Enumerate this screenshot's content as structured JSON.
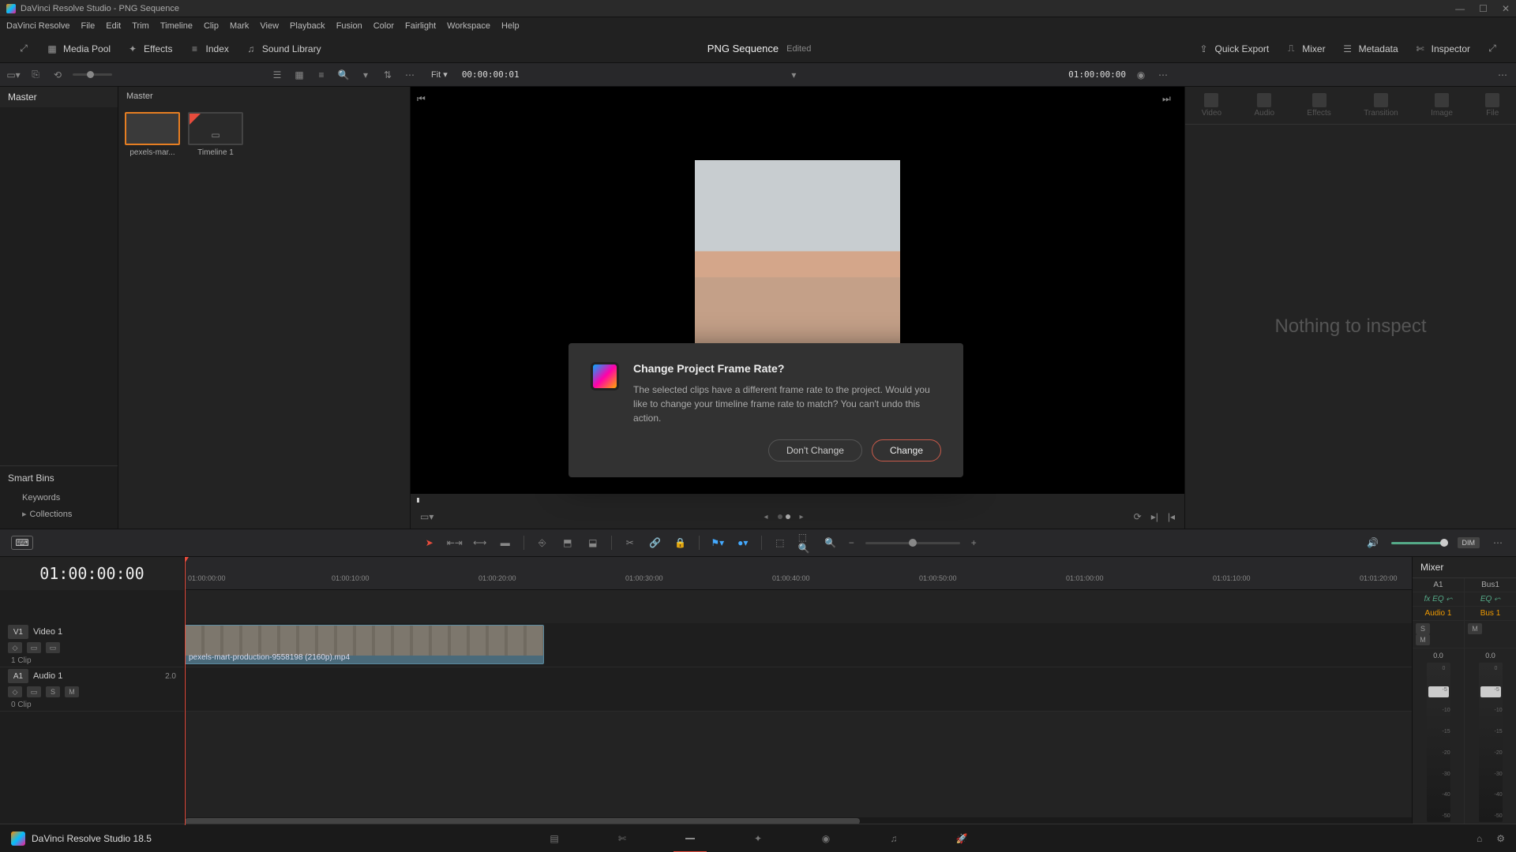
{
  "app": {
    "title": "DaVinci Resolve Studio - PNG Sequence"
  },
  "menu": [
    "DaVinci Resolve",
    "File",
    "Edit",
    "Trim",
    "Timeline",
    "Clip",
    "Mark",
    "View",
    "Playback",
    "Fusion",
    "Color",
    "Fairlight",
    "Workspace",
    "Help"
  ],
  "toolbar": {
    "mediaPool": "Media Pool",
    "effects": "Effects",
    "index": "Index",
    "soundLibrary": "Sound Library",
    "quickExport": "Quick Export",
    "mixer": "Mixer",
    "metadata": "Metadata",
    "inspector": "Inspector",
    "projectTitle": "PNG Sequence",
    "projectState": "Edited"
  },
  "subToolbar": {
    "fit": "Fit",
    "sourceTC": "00:00:00:01",
    "recordTC": "01:00:00:00"
  },
  "mediaPool": {
    "master": "Master",
    "masterCrumb": "Master",
    "clips": [
      {
        "label": "pexels-mar..."
      },
      {
        "label": "Timeline 1"
      }
    ],
    "smartBins": "Smart Bins",
    "keywords": "Keywords",
    "collections": "Collections"
  },
  "inspector": {
    "tabs": [
      "Video",
      "Audio",
      "Effects",
      "Transition",
      "Image",
      "File"
    ],
    "empty": "Nothing to inspect"
  },
  "timeline": {
    "tc": "01:00:00:00",
    "ruler": [
      "01:00:00:00",
      "01:00:10:00",
      "01:00:20:00",
      "01:00:30:00",
      "01:00:40:00",
      "01:00:50:00",
      "01:01:00:00",
      "01:01:10:00",
      "01:01:20:00"
    ],
    "video": {
      "badge": "V1",
      "name": "Video 1",
      "count": "1 Clip"
    },
    "audio": {
      "badge": "A1",
      "name": "Audio 1",
      "ch": "2.0",
      "count": "0 Clip"
    },
    "clipName": "pexels-mart-production-9558198 (2160p).mp4"
  },
  "mixer_panel": {
    "title": "Mixer",
    "a1": "A1",
    "bus1": "Bus1",
    "eq": "EQ",
    "audio1": "Audio 1",
    "bus1b": "Bus 1",
    "s": "S",
    "m": "M",
    "db": "0.0",
    "scale": [
      "0",
      "-5",
      "-10",
      "-15",
      "-20",
      "-30",
      "-40",
      "-50"
    ]
  },
  "dialog": {
    "title": "Change Project Frame Rate?",
    "body": "The selected clips have a different frame rate to the project. Would you like to change your timeline frame rate to match? You can't undo this action.",
    "cancel": "Don't Change",
    "ok": "Change"
  },
  "bottom": {
    "version": "DaVinci Resolve Studio 18.5"
  }
}
